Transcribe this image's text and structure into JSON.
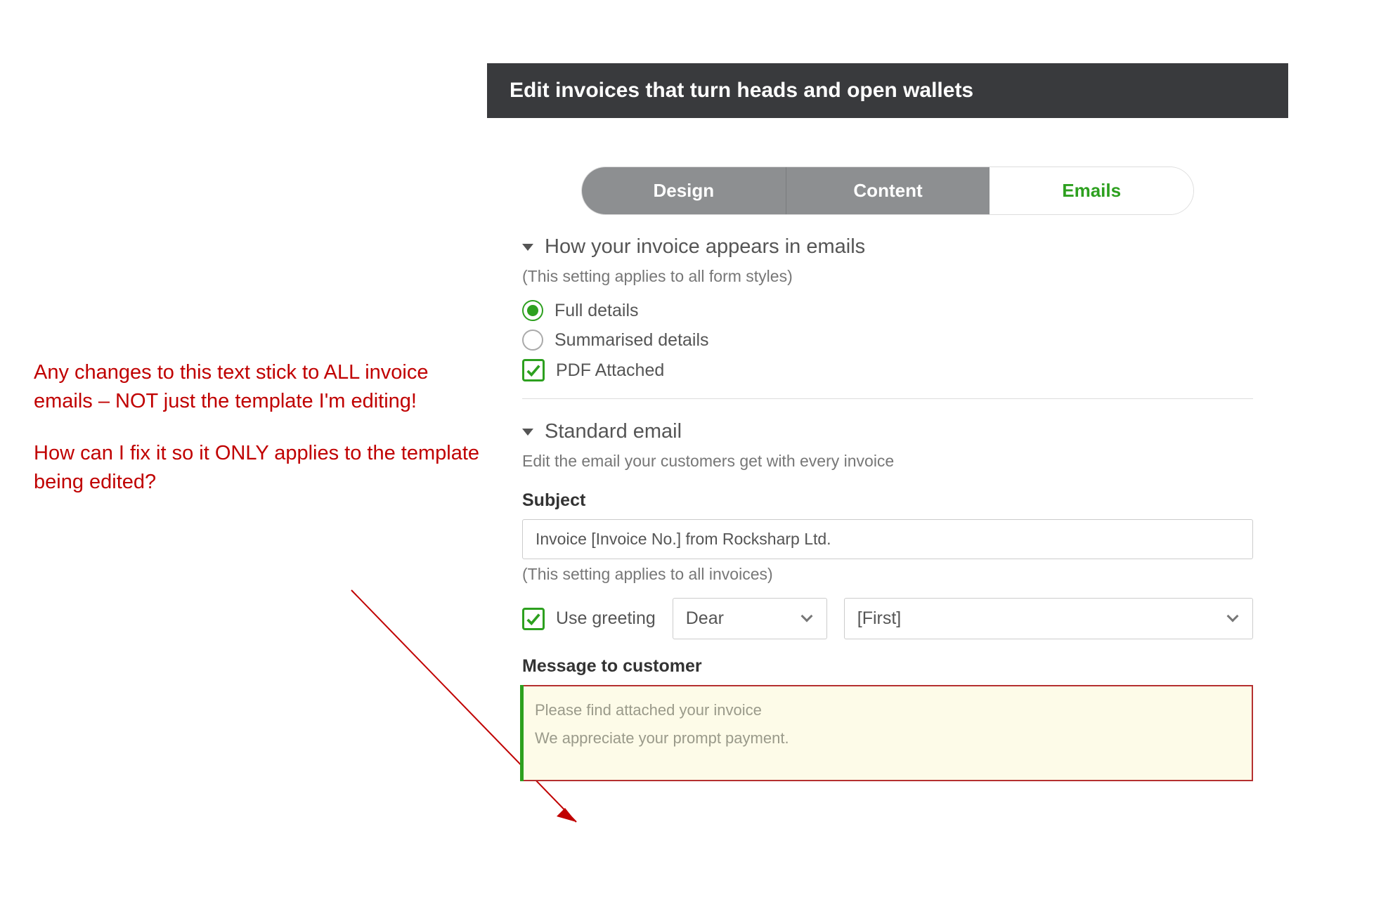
{
  "annotation": {
    "p1": "Any changes to this text stick to ALL invoice emails – NOT just the template I'm editing!",
    "p2": "How can I fix it so it ONLY applies to the template being edited?"
  },
  "header": {
    "title": "Edit invoices that turn heads and open wallets"
  },
  "tabs": {
    "design": "Design",
    "content": "Content",
    "emails": "Emails"
  },
  "appearance": {
    "heading": "How your invoice appears in emails",
    "note": "(This setting applies to all form styles)",
    "full": "Full details",
    "summarised": "Summarised details",
    "pdf": "PDF Attached"
  },
  "standard": {
    "heading": "Standard email",
    "sub": "Edit the email your customers get with every invoice"
  },
  "subject": {
    "label": "Subject",
    "value": "Invoice [Invoice No.] from Rocksharp Ltd.",
    "note": "(This setting applies to all invoices)"
  },
  "greeting": {
    "use": "Use greeting",
    "salutation": "Dear",
    "name_token": "[First]"
  },
  "message": {
    "label": "Message to customer",
    "line1": "Please find attached your invoice",
    "line2": "We appreciate your prompt payment."
  }
}
